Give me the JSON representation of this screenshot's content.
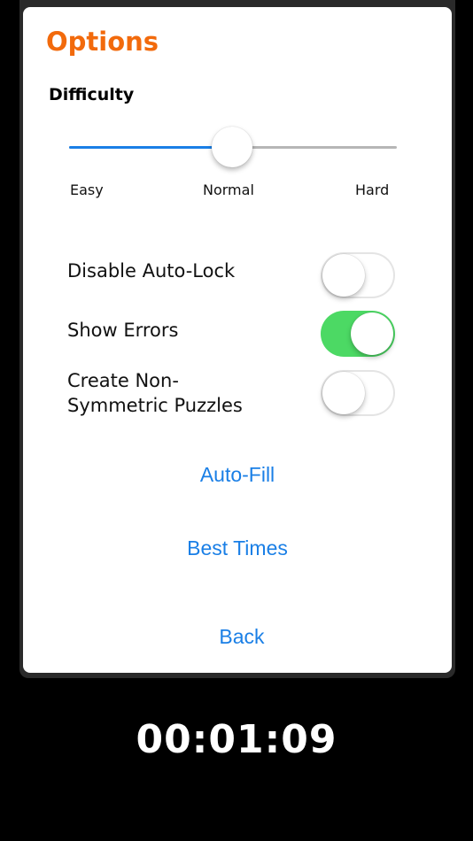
{
  "options": {
    "title": "Options",
    "difficulty": {
      "label": "Difficulty",
      "levels": [
        "Easy",
        "Normal",
        "Hard"
      ],
      "selected": "Normal",
      "value": 0.5
    },
    "settings": [
      {
        "label_line1": "Disable Auto-Lock",
        "label_line2": "",
        "enabled": false
      },
      {
        "label_line1": "Show Errors",
        "label_line2": "",
        "enabled": true
      },
      {
        "label_line1": "Create Non-",
        "label_line2": "Symmetric Puzzles",
        "enabled": false
      }
    ],
    "buttons": {
      "auto_fill": "Auto-Fill",
      "best_times": "Best Times",
      "back": "Back"
    }
  },
  "timer": "00:01:09",
  "colors": {
    "accent_orange": "#f26a0c",
    "link_blue": "#1a7fe6",
    "toggle_on": "#4cd964"
  }
}
